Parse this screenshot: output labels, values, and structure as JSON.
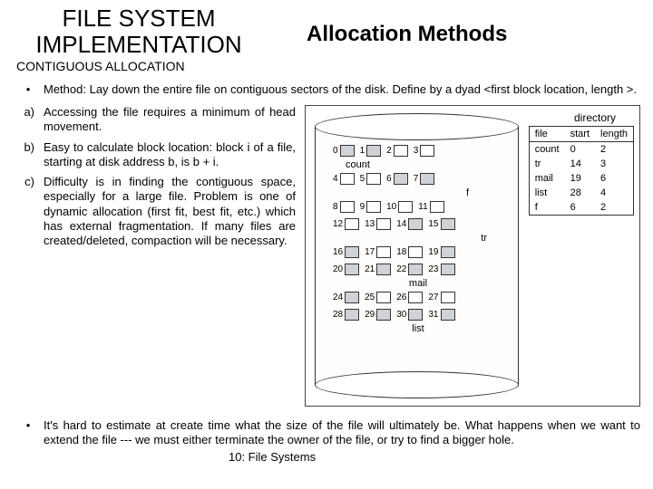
{
  "header": {
    "title_left": "FILE SYSTEM IMPLEMENTATION",
    "title_right": "Allocation Methods",
    "subhead": "CONTIGUOUS ALLOCATION"
  },
  "bullet1": {
    "mark": "•",
    "text": "Method:  Lay down the entire file on contiguous sectors of the disk. Define by a dyad <first block location, length >."
  },
  "items": {
    "a_lab": "a)",
    "a_txt": "Accessing the file requires a minimum of head movement.",
    "b_lab": "b)",
    "b_txt": "Easy to calculate block location: block i of a file, starting at disk address b, is b + i.",
    "c_lab": "c)",
    "c_txt": "Difficulty is in finding the contiguous space, especially for a large file. Problem is one of dynamic allocation (first fit, best fit, etc.) which has external fragmentation. If many files are created/deleted, compaction will be necessary."
  },
  "bullet2": {
    "mark": "•",
    "text": "It's hard to estimate at create time what the size of the file will ultimately be.  What happens when we want to extend the file --- we must either terminate the owner of the file, or try to find a bigger hole."
  },
  "figure": {
    "dir_label": "directory",
    "headers": {
      "file": "file",
      "start": "start",
      "length": "length"
    },
    "rows": [
      {
        "file": "count",
        "start": "0",
        "length": "2"
      },
      {
        "file": "tr",
        "start": "14",
        "length": "3"
      },
      {
        "file": "mail",
        "start": "19",
        "length": "6"
      },
      {
        "file": "list",
        "start": "28",
        "length": "4"
      },
      {
        "file": "f",
        "start": "6",
        "length": "2"
      }
    ],
    "filelabels": {
      "count": "count",
      "f": "f",
      "tr": "tr",
      "mail": "mail",
      "list": "list"
    },
    "blocks": {
      "r0": [
        "0",
        "1",
        "2",
        "3"
      ],
      "r1": [
        "4",
        "5",
        "6",
        "7"
      ],
      "r2": [
        "8",
        "9",
        "10",
        "11"
      ],
      "r3": [
        "12",
        "13",
        "14",
        "15"
      ],
      "r4": [
        "16",
        "17",
        "18",
        "19"
      ],
      "r5": [
        "20",
        "21",
        "22",
        "23"
      ],
      "r6": [
        "24",
        "25",
        "26",
        "27"
      ],
      "r7": [
        "28",
        "29",
        "30",
        "31"
      ]
    }
  },
  "footer": "10: File Systems"
}
